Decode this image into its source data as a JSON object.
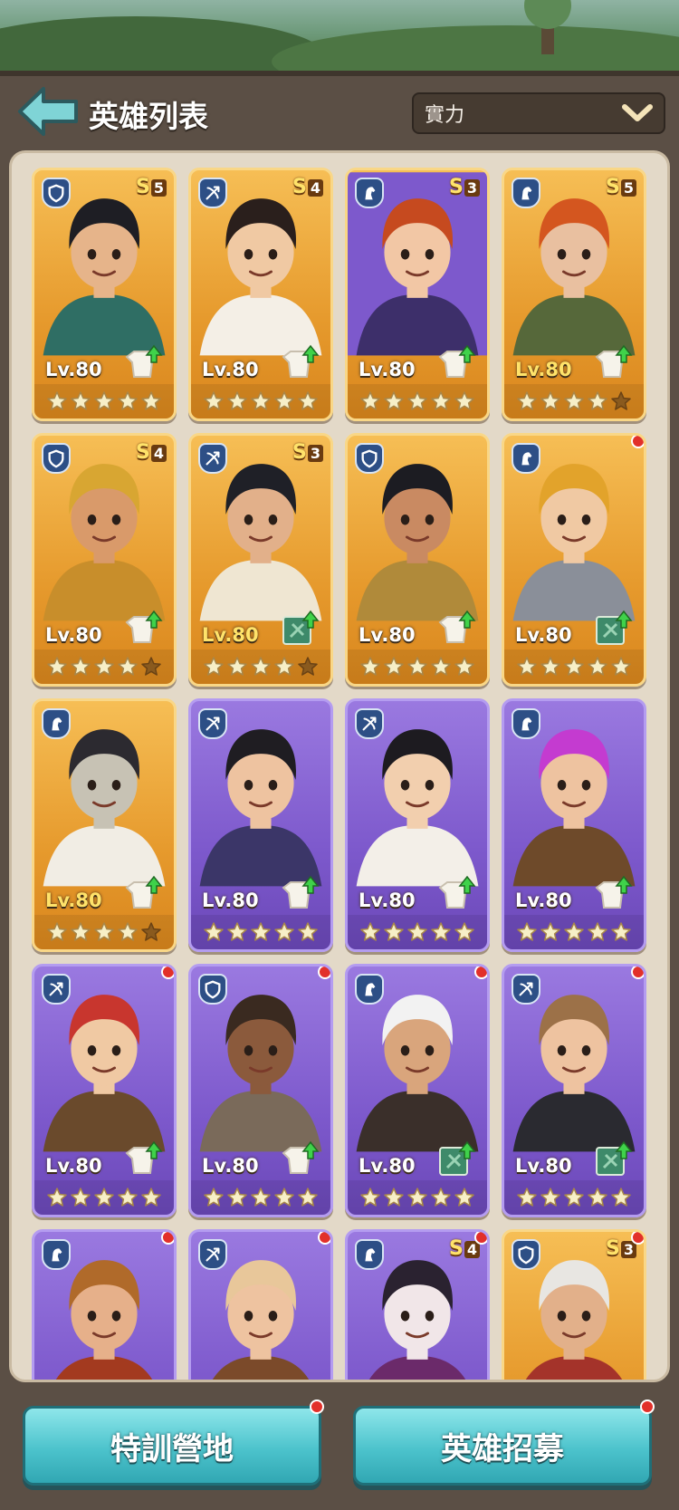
{
  "header": {
    "title": "英雄列表",
    "sort_value": "實力"
  },
  "colors": {
    "gold_card": "#e69a2d",
    "purple_card": "#7d59cc",
    "button": "#4cc3cc",
    "notification": "#e2302a"
  },
  "heroes": [
    {
      "class": "shield",
      "rank": "S",
      "rank_level": "5",
      "level": "Lv.80",
      "stars": 5,
      "tier": "gold",
      "upgrade_icon": "armor-up-icon",
      "dot": false,
      "skin": "#e6b48a",
      "hair": "#1e1e24",
      "cloth": "#2f6e64"
    },
    {
      "class": "bow",
      "rank": "S",
      "rank_level": "4",
      "level": "Lv.80",
      "stars": 5,
      "tier": "gold",
      "upgrade_icon": "armor-up-icon",
      "dot": false,
      "skin": "#f0c9a3",
      "hair": "#2a1f1c",
      "cloth": "#f4efe6"
    },
    {
      "class": "horse",
      "rank": "S",
      "rank_level": "3",
      "level": "Lv.80",
      "stars": 5,
      "tier": "purple-bg",
      "upgrade_icon": "armor-up-icon",
      "dot": false,
      "skin": "#f2c7a5",
      "hair": "#c64a1f",
      "cloth": "#3d2f6a"
    },
    {
      "class": "horse",
      "rank": "S",
      "rank_level": "5",
      "level": "Lv.80",
      "stars": 4,
      "tier": "gold",
      "upgrade_icon": "armor-up-icon",
      "dot": false,
      "skin": "#e9c0a0",
      "hair": "#d4561f",
      "cloth": "#56683a",
      "level_hl": true
    },
    {
      "class": "shield",
      "rank": "S",
      "rank_level": "4",
      "level": "Lv.80",
      "stars": 4,
      "tier": "gold",
      "upgrade_icon": "armor-up-icon",
      "dot": false,
      "skin": "#d99a6a",
      "hair": "#d8a632",
      "cloth": "#c88e2b"
    },
    {
      "class": "bow",
      "rank": "S",
      "rank_level": "3",
      "level": "Lv.80",
      "stars": 4,
      "tier": "gold",
      "upgrade_icon": "book-icon",
      "dot": false,
      "skin": "#e2b08a",
      "hair": "#1f2027",
      "cloth": "#efe6d2",
      "level_hl": true
    },
    {
      "class": "shield",
      "rank": "",
      "rank_level": "",
      "level": "Lv.80",
      "stars": 5,
      "tier": "gold",
      "upgrade_icon": "armor-up-icon",
      "dot": false,
      "skin": "#c98a62",
      "hair": "#1c1c22",
      "cloth": "#b08a3a"
    },
    {
      "class": "horse",
      "rank": "",
      "rank_level": "",
      "level": "Lv.80",
      "stars": 5,
      "tier": "gold",
      "upgrade_icon": "book-icon",
      "dot": true,
      "skin": "#f0c9a3",
      "hair": "#e2a32b",
      "cloth": "#8a8f99"
    },
    {
      "class": "horse",
      "rank": "",
      "rank_level": "",
      "level": "Lv.80",
      "stars": 4,
      "tier": "gold",
      "upgrade_icon": "armor-up-icon",
      "dot": false,
      "skin": "#c7c2b4",
      "hair": "#2c2a30",
      "cloth": "#f1ede4",
      "level_hl": true
    },
    {
      "class": "bow",
      "rank": "",
      "rank_level": "",
      "level": "Lv.80",
      "stars": 5,
      "tier": "purple",
      "upgrade_icon": "armor-up-icon",
      "dot": false,
      "skin": "#eec3a0",
      "hair": "#1f1d22",
      "cloth": "#3b3668"
    },
    {
      "class": "bow",
      "rank": "",
      "rank_level": "",
      "level": "Lv.80",
      "stars": 5,
      "tier": "purple",
      "upgrade_icon": "armor-up-icon",
      "dot": false,
      "skin": "#f2cfae",
      "hair": "#1d1b20",
      "cloth": "#f3efe8"
    },
    {
      "class": "horse",
      "rank": "",
      "rank_level": "",
      "level": "Lv.80",
      "stars": 5,
      "tier": "purple",
      "upgrade_icon": "armor-up-icon",
      "dot": false,
      "skin": "#eec3a0",
      "hair": "#c43bd0",
      "cloth": "#6e4a2a"
    },
    {
      "class": "bow",
      "rank": "",
      "rank_level": "",
      "level": "Lv.80",
      "stars": 5,
      "tier": "purple",
      "upgrade_icon": "armor-up-icon",
      "dot": true,
      "skin": "#f0c9a3",
      "hair": "#c8362e",
      "cloth": "#6a4a2c"
    },
    {
      "class": "shield",
      "rank": "",
      "rank_level": "",
      "level": "Lv.80",
      "stars": 5,
      "tier": "purple",
      "upgrade_icon": "armor-up-icon",
      "dot": true,
      "skin": "#8b5a3c",
      "hair": "#3a2a20",
      "cloth": "#7a6a5a"
    },
    {
      "class": "horse",
      "rank": "",
      "rank_level": "",
      "level": "Lv.80",
      "stars": 5,
      "tier": "purple",
      "upgrade_icon": "book-icon",
      "dot": true,
      "skin": "#d9a57c",
      "hair": "#f2f2f2",
      "cloth": "#3a2f2a"
    },
    {
      "class": "bow",
      "rank": "",
      "rank_level": "",
      "level": "Lv.80",
      "stars": 5,
      "tier": "purple",
      "upgrade_icon": "book-icon",
      "dot": true,
      "skin": "#eec3a0",
      "hair": "#9c7148",
      "cloth": "#2a2a30"
    },
    {
      "class": "horse",
      "rank": "",
      "rank_level": "",
      "level": "",
      "stars": 0,
      "tier": "purple",
      "upgrade_icon": "",
      "dot": true,
      "skin": "#e6b08a",
      "hair": "#b06a2a",
      "cloth": "#a33a1f"
    },
    {
      "class": "bow",
      "rank": "",
      "rank_level": "",
      "level": "",
      "stars": 0,
      "tier": "purple",
      "upgrade_icon": "",
      "dot": true,
      "skin": "#eec3a0",
      "hair": "#e8c79a",
      "cloth": "#7b4a2a"
    },
    {
      "class": "horse",
      "rank": "S",
      "rank_level": "4",
      "level": "",
      "stars": 0,
      "tier": "purple",
      "upgrade_icon": "",
      "dot": true,
      "skin": "#f1e6e8",
      "hair": "#2a2230",
      "cloth": "#6b2a6a"
    },
    {
      "class": "shield",
      "rank": "S",
      "rank_level": "3",
      "level": "",
      "stars": 0,
      "tier": "gold",
      "upgrade_icon": "",
      "dot": true,
      "skin": "#e2b08a",
      "hair": "#e8e6e2",
      "cloth": "#a4332a"
    }
  ],
  "buttons": {
    "training": "特訓營地",
    "recruit": "英雄招募"
  }
}
